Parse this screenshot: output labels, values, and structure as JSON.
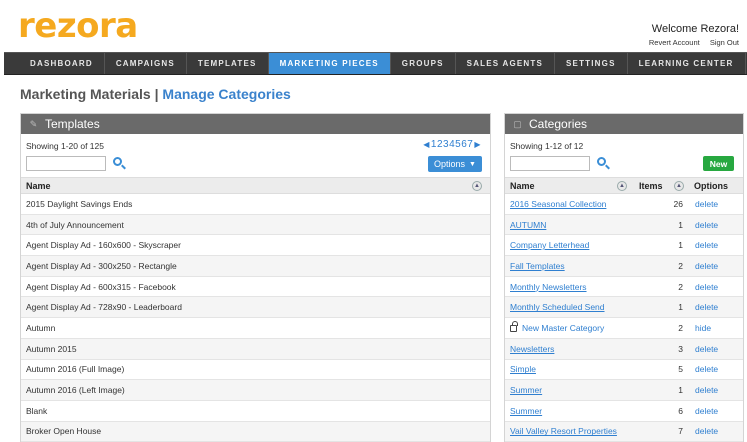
{
  "app": {
    "logo": "rezora"
  },
  "account": {
    "welcome": "Welcome Rezora!",
    "revert": "Revert Account",
    "signout": "Sign Out"
  },
  "nav": [
    "DASHBOARD",
    "CAMPAIGNS",
    "TEMPLATES",
    "MARKETING PIECES",
    "GROUPS",
    "SALES AGENTS",
    "SETTINGS",
    "LEARNING CENTER"
  ],
  "nav_active": "MARKETING PIECES",
  "page": {
    "title": "Marketing Materials |",
    "link": "Manage Categories"
  },
  "templates": {
    "header": "Templates",
    "showing": "Showing 1-20 of 125",
    "pages": [
      "1",
      "2",
      "3",
      "4",
      "5",
      "6",
      "7"
    ],
    "options_label": "Options",
    "col_name": "Name",
    "rows": [
      "2015 Daylight Savings Ends",
      "4th of July Announcement",
      "Agent Display Ad - 160x600 - Skyscraper",
      "Agent Display Ad - 300x250 - Rectangle",
      "Agent Display Ad - 600x315 - Facebook",
      "Agent Display Ad - 728x90 - Leaderboard",
      "Autumn",
      "Autumn 2015",
      "Autumn 2016 (Full Image)",
      "Autumn 2016 (Left Image)",
      "Blank",
      "Broker Open House"
    ]
  },
  "categories": {
    "header": "Categories",
    "showing": "Showing 1-12 of 12",
    "new_label": "New",
    "col_name": "Name",
    "col_items": "Items",
    "col_options": "Options",
    "rows": [
      {
        "name": "2016 Seasonal Collection",
        "items": "26",
        "action": "delete",
        "locked": false
      },
      {
        "name": "AUTUMN",
        "items": "1",
        "action": "delete",
        "locked": false
      },
      {
        "name": "Company Letterhead",
        "items": "1",
        "action": "delete",
        "locked": false
      },
      {
        "name": "Fall Templates",
        "items": "2",
        "action": "delete",
        "locked": false
      },
      {
        "name": "Monthly Newsletters",
        "items": "2",
        "action": "delete",
        "locked": false
      },
      {
        "name": "Monthly Scheduled Send",
        "items": "1",
        "action": "delete",
        "locked": false
      },
      {
        "name": "New Master Category",
        "items": "2",
        "action": "hide",
        "locked": true
      },
      {
        "name": "Newsletters",
        "items": "3",
        "action": "delete",
        "locked": false
      },
      {
        "name": "Simple",
        "items": "5",
        "action": "delete",
        "locked": false
      },
      {
        "name": "Summer",
        "items": "1",
        "action": "delete",
        "locked": false
      },
      {
        "name": "Summer",
        "items": "6",
        "action": "delete",
        "locked": false
      },
      {
        "name": "Vail Valley Resort Properties",
        "items": "7",
        "action": "delete",
        "locked": false
      }
    ]
  },
  "colors": {
    "brand": "#f5a91f",
    "nav_bg": "#3a3a3a",
    "accent": "#3b8ed6",
    "new_button": "#27a840",
    "panel_head": "#6a6a6a"
  }
}
